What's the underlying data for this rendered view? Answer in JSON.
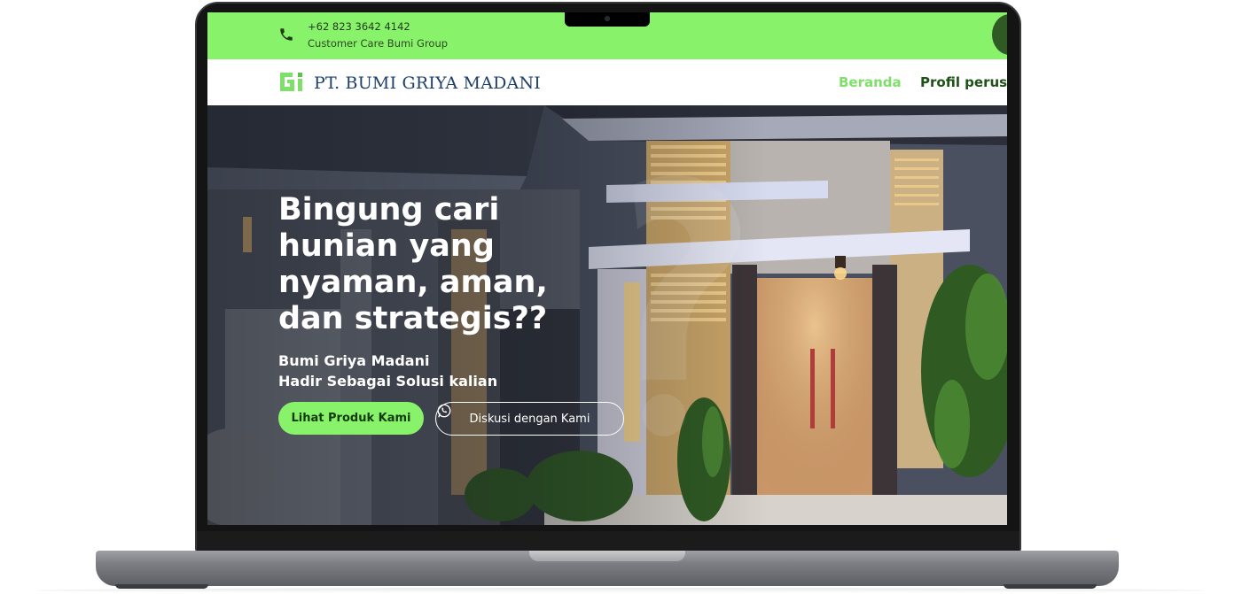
{
  "topbar": {
    "phone": "+62 823 3642 4142",
    "caption": "Customer Care Bumi Group",
    "icon": "phone-icon",
    "color": "#88f26b"
  },
  "navbar": {
    "logo_text": "PT. BUMI GRIYA MADANI",
    "items": [
      {
        "label": "Beranda",
        "active": true
      },
      {
        "label": "Profil perusa",
        "active": false
      }
    ],
    "active_color": "#7ee06a",
    "text_color": "#1d5116"
  },
  "hero": {
    "headline": "Bingung cari hunian yang nyaman, aman, dan strategis??",
    "subline_1": "Bumi Griya Madani",
    "subline_2": "Hadir Sebagai Solusi kalian",
    "primary_button": "Lihat Produk Kami",
    "secondary_button": "Diskusi dengan Kami",
    "secondary_icon": "whatsapp-icon"
  }
}
